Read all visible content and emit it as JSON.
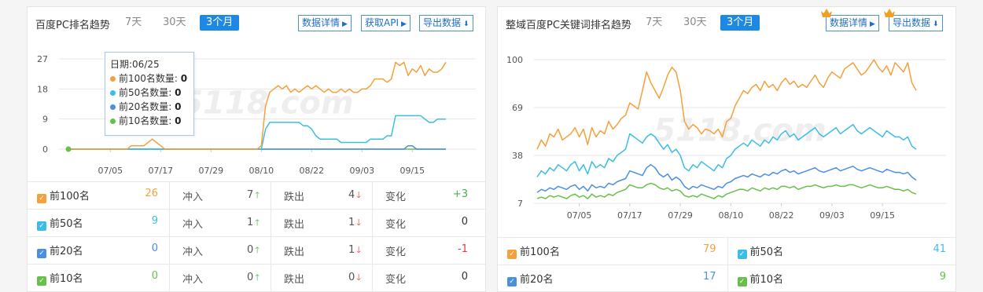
{
  "colors": {
    "orange": "#f5a03c",
    "cyan": "#3cbde6",
    "blue": "#4a8fe0",
    "green": "#66c04a",
    "accent": "#1e88e5",
    "red": "#e53935"
  },
  "panel1": {
    "title": "百度PC排名趋势",
    "tabs": [
      "7天",
      "30天",
      "3个月"
    ],
    "active_tab": "3个月",
    "btn_details": "数据详情",
    "btn_api": "获取API",
    "btn_export": "导出数据",
    "watermark": "5118.com",
    "tooltip": {
      "date": "日期:06/25",
      "rows": [
        {
          "label": "前100名数量:",
          "value": "0",
          "color": "#f5a03c"
        },
        {
          "label": "前50名数量:",
          "value": "0",
          "color": "#3cbde6"
        },
        {
          "label": "前20名数量:",
          "value": "0",
          "color": "#4a8fe0"
        },
        {
          "label": "前10名数量:",
          "value": "0",
          "color": "#66c04a"
        }
      ]
    },
    "stats": [
      {
        "name": "前100名",
        "value": "26",
        "color": "#f5a03c",
        "in_label": "冲入",
        "in": "7",
        "out_label": "跌出",
        "out": "4",
        "chg_label": "变化",
        "chg": "+3",
        "chg_color": "#4caf50"
      },
      {
        "name": "前50名",
        "value": "9",
        "color": "#3cbde6",
        "in_label": "冲入",
        "in": "1",
        "out_label": "跌出",
        "out": "1",
        "chg_label": "变化",
        "chg": "0",
        "chg_color": "#333333"
      },
      {
        "name": "前20名",
        "value": "0",
        "color": "#4a8fe0",
        "in_label": "冲入",
        "in": "0",
        "out_label": "跌出",
        "out": "1",
        "chg_label": "变化",
        "chg": "-1",
        "chg_color": "#e53935"
      },
      {
        "name": "前10名",
        "value": "0",
        "color": "#66c04a",
        "in_label": "冲入",
        "in": "0",
        "out_label": "跌出",
        "out": "0",
        "chg_label": "变化",
        "chg": "0",
        "chg_color": "#333333"
      }
    ]
  },
  "panel2": {
    "title": "整域百度PC关键词排名趋势",
    "tabs": [
      "7天",
      "30天",
      "3个月"
    ],
    "active_tab": "3个月",
    "btn_details": "数据详情",
    "btn_export": "导出数据",
    "watermark": "5118.com",
    "stats": [
      {
        "name": "前100名",
        "value": "79",
        "color": "#f5a03c"
      },
      {
        "name": "前50名",
        "value": "41",
        "color": "#3cbde6"
      },
      {
        "name": "前20名",
        "value": "17",
        "color": "#4a8fe0"
      },
      {
        "name": "前10名",
        "value": "9",
        "color": "#66c04a"
      }
    ]
  },
  "chart_data": [
    {
      "type": "line",
      "ylim": [
        0,
        27
      ],
      "yticks": [
        0,
        9,
        18,
        27
      ],
      "xticks": [
        "07/05",
        "07/17",
        "07/29",
        "08/10",
        "08/22",
        "09/03",
        "09/15"
      ],
      "x_tick_index": [
        10,
        22,
        34,
        46,
        58,
        70,
        82
      ],
      "grid": true,
      "series": [
        {
          "name": "前100名",
          "color": "#f5a03c",
          "values": [
            0,
            0,
            0,
            0,
            0,
            0,
            0,
            0,
            0,
            0,
            0,
            0,
            0,
            0,
            0,
            1,
            1,
            1,
            1,
            2,
            3,
            2,
            1,
            0,
            0,
            0,
            0,
            0,
            0,
            0,
            0,
            0,
            0,
            0,
            0,
            0,
            0,
            0,
            0,
            0,
            0,
            0,
            0,
            0,
            0,
            0,
            1,
            13,
            17,
            18,
            19,
            18,
            19,
            17,
            18,
            17,
            18,
            19,
            18,
            19,
            18,
            17,
            18,
            17,
            17,
            18,
            17,
            18,
            17,
            17,
            18,
            18,
            19,
            21,
            21,
            21,
            20,
            21,
            26,
            25,
            26,
            22,
            24,
            23,
            25,
            22,
            24,
            23,
            23,
            24,
            26
          ]
        },
        {
          "name": "前50名",
          "color": "#3cbde6",
          "values": [
            0,
            0,
            0,
            0,
            0,
            0,
            0,
            0,
            0,
            0,
            0,
            0,
            0,
            0,
            0,
            0,
            0,
            0,
            0,
            0,
            0,
            0,
            0,
            0,
            0,
            0,
            0,
            0,
            0,
            0,
            0,
            0,
            0,
            0,
            0,
            0,
            0,
            0,
            0,
            0,
            0,
            0,
            0,
            0,
            0,
            0,
            0,
            6,
            8,
            8,
            8,
            8,
            8,
            8,
            8,
            8,
            7,
            7,
            6,
            4,
            3,
            3,
            3,
            3,
            3,
            2,
            2,
            2,
            2,
            2,
            2,
            2,
            3,
            3,
            3,
            3,
            4,
            4,
            10,
            10,
            10,
            10,
            10,
            10,
            10,
            9,
            8,
            8,
            9,
            9,
            9
          ]
        },
        {
          "name": "前20名",
          "color": "#4a8fe0",
          "values": [
            0,
            0,
            0,
            0,
            0,
            0,
            0,
            0,
            0,
            0,
            0,
            0,
            0,
            0,
            0,
            0,
            0,
            0,
            0,
            0,
            0,
            0,
            0,
            0,
            0,
            0,
            0,
            0,
            0,
            0,
            0,
            0,
            0,
            0,
            0,
            0,
            0,
            0,
            0,
            0,
            0,
            0,
            0,
            0,
            0,
            0,
            0,
            0,
            0,
            0,
            0,
            0,
            0,
            0,
            0,
            0,
            0,
            0,
            0,
            0,
            0,
            0,
            0,
            0,
            0,
            0,
            0,
            0,
            0,
            0,
            0,
            0,
            0,
            0,
            0,
            0,
            0,
            0,
            0,
            0,
            0,
            1,
            1,
            0,
            0,
            0,
            0,
            0,
            0,
            0,
            0
          ]
        },
        {
          "name": "前10名",
          "color": "#66c04a",
          "values": [
            0,
            0,
            0,
            0,
            0,
            0,
            0,
            0,
            0,
            0,
            0,
            0,
            0,
            0,
            0,
            0,
            0,
            0,
            0,
            0,
            0,
            0,
            0,
            0,
            0,
            0,
            0,
            0,
            0,
            0,
            0,
            0,
            0,
            0,
            0,
            0,
            0,
            0,
            0,
            0,
            0,
            0,
            0,
            0,
            0,
            0,
            0,
            0,
            0,
            0,
            0,
            0,
            0,
            0,
            0,
            0,
            0,
            0,
            0,
            0,
            0,
            0,
            0,
            0,
            0,
            0,
            0,
            0,
            0,
            0,
            0,
            0,
            0,
            0,
            0,
            0,
            0,
            0,
            0,
            0,
            0,
            0,
            0,
            0,
            0,
            0,
            0,
            0,
            0,
            0,
            0
          ]
        }
      ]
    },
    {
      "type": "line",
      "ylim": [
        7,
        100
      ],
      "yticks": [
        7,
        38,
        69,
        100
      ],
      "xticks": [
        "07/05",
        "07/17",
        "07/29",
        "08/10",
        "08/22",
        "09/03",
        "09/15"
      ],
      "x_tick_index": [
        10,
        22,
        34,
        46,
        58,
        70,
        82
      ],
      "grid": true,
      "series": [
        {
          "name": "前100名",
          "color": "#f5a03c",
          "values": [
            42,
            48,
            44,
            52,
            50,
            55,
            48,
            50,
            52,
            56,
            50,
            55,
            45,
            56,
            50,
            54,
            52,
            60,
            55,
            58,
            62,
            64,
            72,
            70,
            68,
            80,
            92,
            85,
            80,
            75,
            82,
            90,
            95,
            92,
            80,
            60,
            55,
            58,
            56,
            52,
            55,
            54,
            52,
            55,
            50,
            60,
            62,
            70,
            75,
            80,
            78,
            82,
            84,
            80,
            86,
            82,
            84,
            80,
            85,
            88,
            84,
            86,
            82,
            84,
            82,
            86,
            90,
            85,
            82,
            88,
            92,
            90,
            88,
            94,
            96,
            98,
            94,
            90,
            92,
            96,
            100,
            95,
            92,
            96,
            90,
            98,
            95,
            92,
            98,
            85,
            80
          ]
        },
        {
          "name": "前50名",
          "color": "#3cbde6",
          "values": [
            24,
            28,
            26,
            30,
            28,
            32,
            30,
            28,
            32,
            34,
            28,
            32,
            26,
            34,
            30,
            32,
            30,
            36,
            34,
            38,
            40,
            42,
            52,
            50,
            48,
            46,
            50,
            52,
            50,
            46,
            42,
            45,
            40,
            42,
            38,
            30,
            28,
            32,
            30,
            34,
            32,
            30,
            28,
            32,
            30,
            36,
            38,
            42,
            44,
            46,
            44,
            48,
            46,
            44,
            48,
            46,
            50,
            48,
            52,
            54,
            50,
            52,
            48,
            50,
            52,
            54,
            56,
            52,
            50,
            52,
            54,
            56,
            52,
            54,
            56,
            58,
            54,
            52,
            54,
            56,
            54,
            52,
            50,
            54,
            52,
            50,
            50,
            48,
            50,
            44,
            42
          ]
        },
        {
          "name": "前20名",
          "color": "#4a8fe0",
          "values": [
            14,
            16,
            15,
            17,
            16,
            18,
            17,
            16,
            18,
            19,
            16,
            18,
            15,
            19,
            17,
            18,
            17,
            20,
            19,
            21,
            22,
            23,
            28,
            27,
            26,
            25,
            30,
            32,
            30,
            26,
            24,
            26,
            22,
            24,
            22,
            18,
            16,
            18,
            17,
            19,
            18,
            17,
            16,
            18,
            17,
            20,
            21,
            23,
            24,
            25,
            24,
            26,
            25,
            24,
            26,
            25,
            27,
            26,
            28,
            29,
            27,
            28,
            26,
            27,
            28,
            29,
            30,
            28,
            27,
            28,
            29,
            30,
            28,
            29,
            30,
            31,
            29,
            28,
            29,
            30,
            29,
            28,
            27,
            29,
            28,
            27,
            27,
            26,
            27,
            24,
            22
          ]
        },
        {
          "name": "前10名",
          "color": "#66c04a",
          "values": [
            10,
            11,
            10,
            12,
            11,
            12,
            11,
            10,
            12,
            13,
            11,
            12,
            10,
            13,
            11,
            12,
            11,
            13,
            12,
            14,
            15,
            16,
            19,
            18,
            17,
            17,
            19,
            20,
            19,
            17,
            16,
            17,
            15,
            16,
            15,
            12,
            11,
            12,
            11,
            13,
            12,
            11,
            10,
            12,
            11,
            13,
            14,
            15,
            16,
            16,
            15,
            17,
            16,
            15,
            17,
            16,
            17,
            16,
            18,
            18,
            17,
            18,
            16,
            17,
            18,
            18,
            19,
            18,
            17,
            18,
            18,
            19,
            18,
            18,
            19,
            19,
            18,
            17,
            18,
            19,
            18,
            17,
            17,
            18,
            17,
            16,
            16,
            15,
            16,
            14,
            13
          ]
        }
      ]
    }
  ]
}
